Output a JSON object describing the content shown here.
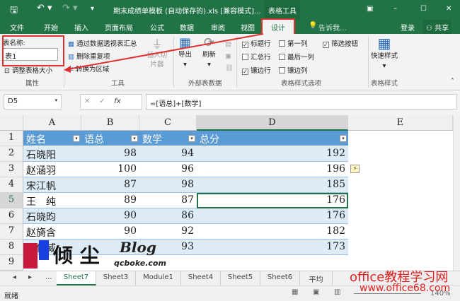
{
  "title_bar": {
    "save_icon": "save-icon",
    "title": "期末成绩单模板 (自动保存的).xls  [兼容模式]...",
    "context_tab": "表格工具"
  },
  "menu_tabs": [
    "文件",
    "开始",
    "插入",
    "页面布局",
    "公式",
    "数据",
    "审阅",
    "视图",
    "设计"
  ],
  "tell_me": "告诉我...",
  "login": "登录",
  "share": "共享",
  "ribbon": {
    "properties": {
      "name_label": "表名称:",
      "name_value": "表1",
      "resize": "调整表格大小",
      "group": "属性"
    },
    "tools": {
      "pivot": "通过数据透视表汇总",
      "remove_dup": "删除重复项",
      "convert": "转换为区域",
      "slicer": "插入切片器",
      "group": "工具"
    },
    "external": {
      "export": "导出",
      "refresh": "刷新",
      "group": "外部表数据"
    },
    "style_options": {
      "header_row": "标题行",
      "first_col": "第一列",
      "filter_btn": "筛选按钮",
      "total_row": "汇总行",
      "last_col": "最后一列",
      "banded_rows": "镶边行",
      "banded_cols": "镶边列",
      "group": "表格样式选项",
      "checked": {
        "header_row": true,
        "first_col": false,
        "filter_btn": true,
        "total_row": false,
        "last_col": false,
        "banded_rows": true,
        "banded_cols": false
      }
    },
    "styles": {
      "quick": "快速样式",
      "group": "表格样式"
    }
  },
  "formula_bar": {
    "cell_ref": "D5",
    "formula": "=[语总]+[数学]"
  },
  "columns": [
    "A",
    "B",
    "C",
    "D",
    "E"
  ],
  "rows": [
    "1",
    "2",
    "3",
    "4",
    "5",
    "6",
    "7",
    "8",
    "9"
  ],
  "table": {
    "headers": [
      "姓名",
      "语总",
      "数学",
      "总分"
    ],
    "data": [
      [
        "石晓阳",
        "98",
        "94",
        "192"
      ],
      [
        "赵涵羽",
        "100",
        "96",
        "196"
      ],
      [
        "宋江帆",
        "87",
        "98",
        "185"
      ],
      [
        "王　纯",
        "89",
        "87",
        "176"
      ],
      [
        "石晓昀",
        "90",
        "86",
        "176"
      ],
      [
        "赵旖含",
        "90",
        "92",
        "182"
      ],
      [
        "袁仕威",
        "",
        "93",
        "173"
      ]
    ]
  },
  "sheets": [
    "Sheet7",
    "Sheet3",
    "Module1",
    "Sheet4",
    "Sheet5",
    "Sheet6",
    "平均分"
  ],
  "status": {
    "ready": "就绪",
    "zoom": "140%"
  },
  "watermarks": {
    "blog": "倾尘 Blog qcboke.com",
    "site": "office教程学习网",
    "url": "www.office68.com"
  }
}
